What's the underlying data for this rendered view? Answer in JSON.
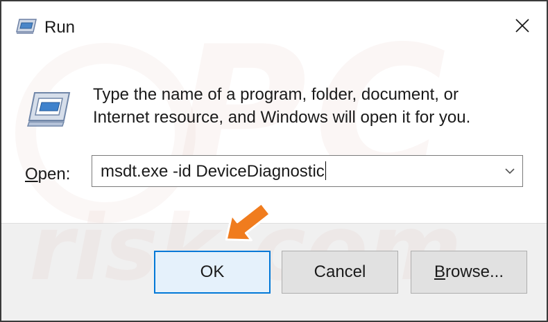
{
  "window": {
    "title": "Run",
    "icon": "run-icon",
    "close_icon": "close-icon"
  },
  "prompt": {
    "line1": "Type the name of a program, folder, document, or",
    "line2": "Internet resource, and Windows will open it for you."
  },
  "open": {
    "label_accel": "O",
    "label_rest": "pen:",
    "value": "msdt.exe -id DeviceDiagnostic",
    "dropdown_icon": "chevron-down-icon"
  },
  "buttons": {
    "ok": "OK",
    "cancel": "Cancel",
    "browse_accel": "B",
    "browse_rest": "rowse..."
  },
  "annotation": {
    "arrow_color": "#f07c1e",
    "icon": "pointer-arrow-icon"
  },
  "watermark": {
    "pc": "PC",
    "risk": "risk.com"
  },
  "colors": {
    "accent": "#0078d7"
  }
}
